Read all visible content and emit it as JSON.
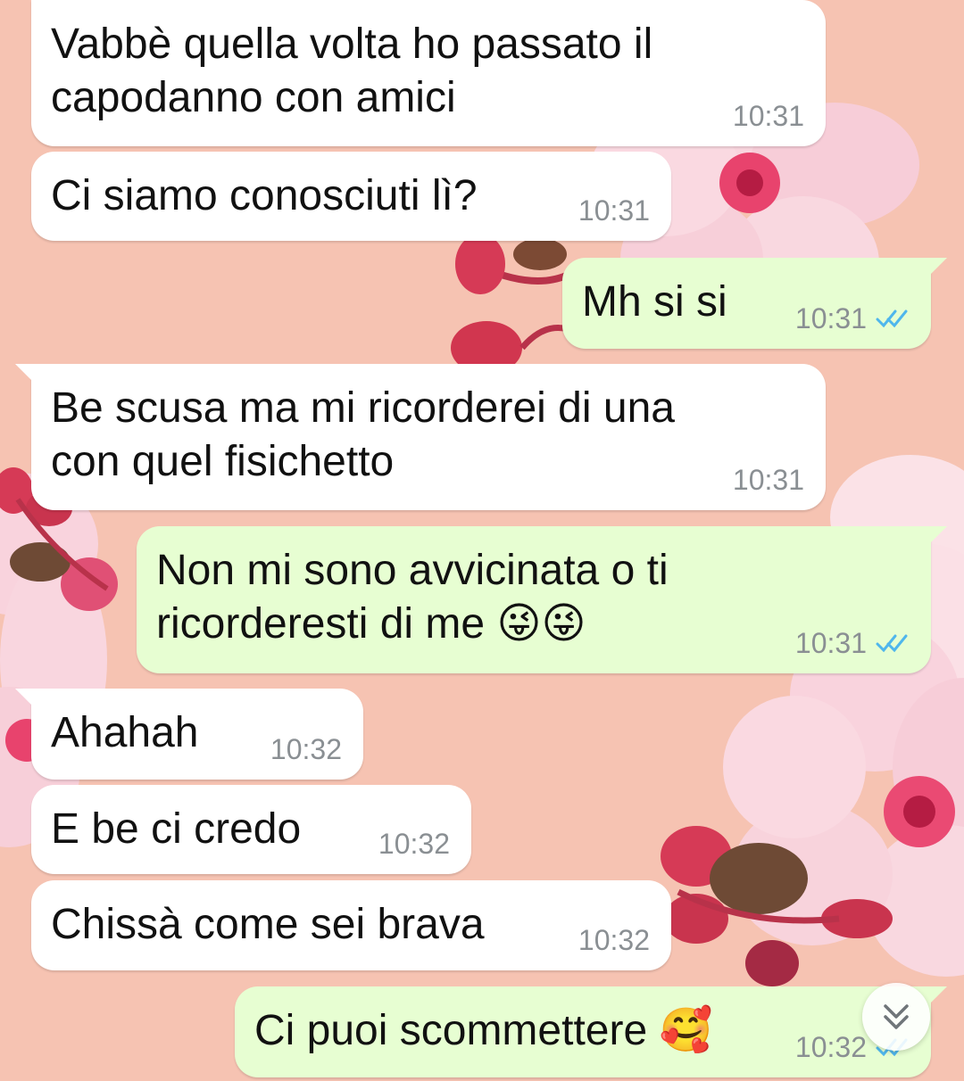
{
  "messages": [
    {
      "id": "m1",
      "dir": "in",
      "text": "Vabbè quella volta ho passato il\ncapodanno con amici",
      "time": "10:31"
    },
    {
      "id": "m2",
      "dir": "in",
      "text": "Ci siamo conosciuti lì?",
      "time": "10:31"
    },
    {
      "id": "m3",
      "dir": "out",
      "text": "Mh si si",
      "time": "10:31",
      "status": "read"
    },
    {
      "id": "m4",
      "dir": "in",
      "text": "Be scusa ma mi ricorderei di una\ncon quel fisichetto",
      "time": "10:31"
    },
    {
      "id": "m5",
      "dir": "out",
      "text": "Non mi sono avvicinata o ti\nricorderesti di me 😜😜",
      "time": "10:31",
      "status": "read"
    },
    {
      "id": "m6",
      "dir": "in",
      "text": "Ahahah",
      "time": "10:32"
    },
    {
      "id": "m7",
      "dir": "in",
      "text": "E be ci credo",
      "time": "10:32"
    },
    {
      "id": "m8",
      "dir": "in",
      "text": "Chissà come sei brava",
      "time": "10:32"
    },
    {
      "id": "m9",
      "dir": "out",
      "text": "Ci puoi scommettere 🥰",
      "time": "10:32",
      "status": "read"
    }
  ],
  "colors": {
    "wallpaper": "#f6c3b2",
    "incoming_bubble": "#ffffff",
    "outgoing_bubble": "#e7fed2",
    "timestamp": "#8a8f93",
    "read_ticks": "#4fb6ec"
  },
  "icons": {
    "read_status": "double-check-icon",
    "scroll_down": "chevron-double-down-icon"
  }
}
